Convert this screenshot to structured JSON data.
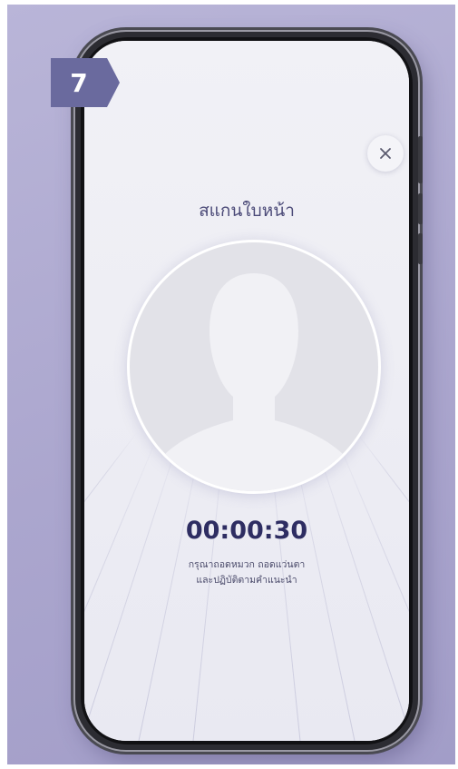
{
  "step": {
    "number": "7"
  },
  "screen": {
    "title": "สแกนใบหน้า",
    "timer": "00:00:30",
    "instruction_line_1": "กรุณาถอดหมวก ถอดแว่นตา",
    "instruction_line_2": "และปฏิบัติตามคำแนะนำ"
  },
  "icons": {
    "close": "close-icon",
    "face_placeholder": "person-silhouette-icon"
  },
  "colors": {
    "background": "#aba6ce",
    "badge": "#6a6a9e",
    "badge_dark": "#4e4e7e",
    "title_text": "#4b4a78",
    "timer_text": "#2e2d62",
    "screen": "#efeff5"
  }
}
